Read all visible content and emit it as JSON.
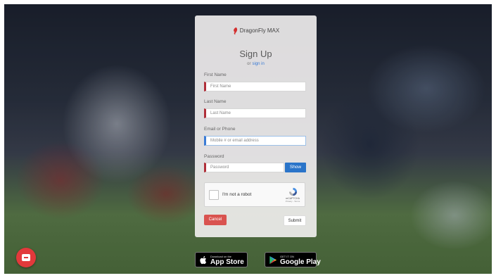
{
  "brand": {
    "name": "DragonFly MAX",
    "logo_icon": "dragonfly-logo-icon",
    "accent": "#d9534f"
  },
  "form": {
    "title": "Sign Up",
    "or_text": "or",
    "sign_in_link": "sign in",
    "first_name": {
      "label": "First Name",
      "placeholder": "First Name"
    },
    "last_name": {
      "label": "Last Name",
      "placeholder": "Last Name"
    },
    "contact": {
      "label": "Email or Phone",
      "placeholder": "Mobile # or email address"
    },
    "password": {
      "label": "Password",
      "placeholder": "Password"
    },
    "show_label": "Show",
    "captcha": {
      "text": "I'm not a robot",
      "brand": "reCAPTCHA",
      "links": "Privacy - Terms"
    },
    "cancel_label": "Cancel",
    "submit_label": "Submit"
  },
  "stores": {
    "apple": {
      "small": "Download on the",
      "big": "App Store"
    },
    "google": {
      "small": "GET IT ON",
      "big": "Google Play"
    }
  },
  "chat": {
    "icon": "chat-bubble-icon",
    "color": "#e2393b"
  }
}
